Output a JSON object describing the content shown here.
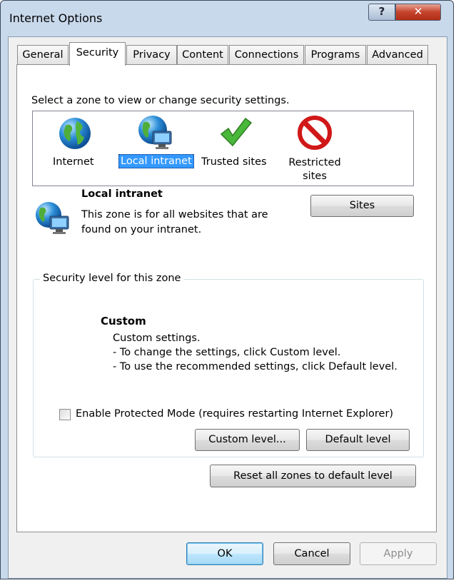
{
  "window": {
    "title": "Internet Options",
    "help_label": "?",
    "close_label": "✕"
  },
  "tabs": [
    {
      "label": "General"
    },
    {
      "label": "Security"
    },
    {
      "label": "Privacy"
    },
    {
      "label": "Content"
    },
    {
      "label": "Connections"
    },
    {
      "label": "Programs"
    },
    {
      "label": "Advanced"
    }
  ],
  "active_tab": "Security",
  "zones": {
    "prompt": "Select a zone to view or change security settings.",
    "items": [
      {
        "label": "Internet",
        "icon": "globe-icon"
      },
      {
        "label": "Local intranet",
        "icon": "intranet-icon",
        "selected": true
      },
      {
        "label": "Trusted sites",
        "icon": "checkmark-icon"
      },
      {
        "label": "Restricted\nsites",
        "icon": "no-entry-icon"
      }
    ]
  },
  "zone_info": {
    "title": "Local intranet",
    "description": "This zone is for all websites that are found on your intranet.",
    "sites_label": "Sites"
  },
  "security_level": {
    "legend": "Security level for this zone",
    "level_title": "Custom",
    "lines": [
      "Custom settings.",
      "- To change the settings, click Custom level.",
      "- To use the recommended settings, click Default level."
    ],
    "protected_mode_label": "Enable Protected Mode (requires restarting Internet Explorer)",
    "protected_mode_checked": false,
    "custom_level_label": "Custom level...",
    "default_level_label": "Default level"
  },
  "reset_label": "Reset all zones to default level",
  "footer": {
    "ok_label": "OK",
    "cancel_label": "Cancel",
    "apply_label": "Apply"
  },
  "colors": {
    "selection": "#3399ff",
    "close_button": "#c4432c",
    "frame": "#c9d9ec"
  }
}
